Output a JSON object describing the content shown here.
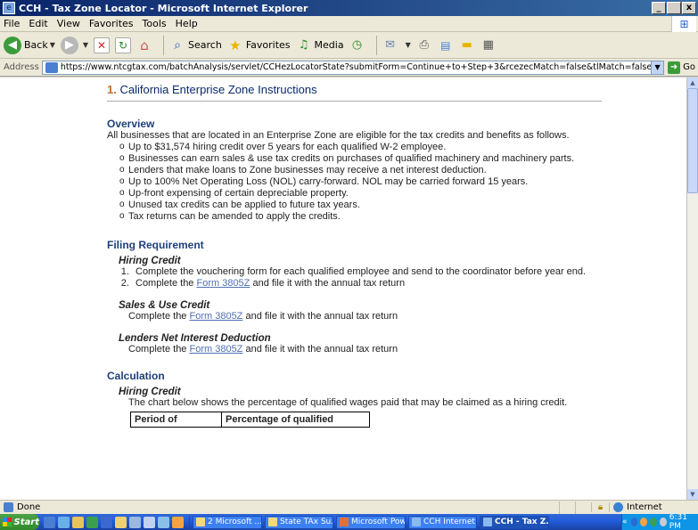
{
  "window": {
    "title": "CCH - Tax Zone Locator - Microsoft Internet Explorer",
    "min": "_",
    "max": " ",
    "close": "x"
  },
  "menu": [
    "File",
    "Edit",
    "View",
    "Favorites",
    "Tools",
    "Help"
  ],
  "toolbar": {
    "back": "Back",
    "search": "Search",
    "favorites": "Favorites",
    "media": "Media"
  },
  "address": {
    "label": "Address",
    "url": "https://www.ntcgtax.com/batchAnalysis/servlet/CCHezLocatorState?submitForm=Continue+to+Step+3&rcezecMatch=false&tlMatch=false&goMatch=false&ezMatch=true&ezName=",
    "go": "Go"
  },
  "page": {
    "heading_num": "1.",
    "heading": "California Enterprise Zone Instructions",
    "overview_title": "Overview",
    "overview_text": "All businesses that are located in an Enterprise Zone are eligible for the tax credits and benefits as follows.",
    "overview_items": [
      "Up to $31,574 hiring credit over 5 years for each qualified W-2 employee.",
      "Businesses can earn sales & use tax credits on purchases of qualified machinery and machinery parts.",
      "Lenders that make loans to Zone businesses may receive a net interest deduction.",
      "Up to 100% Net Operating Loss (NOL) carry-forward. NOL may be carried forward 15 years.",
      "Up-front expensing of certain depreciable property.",
      "Unused tax credits can be applied to future tax years.",
      "Tax returns can be amended to apply the credits."
    ],
    "filing_title": "Filing Requirement",
    "hiring_credit": "Hiring Credit",
    "hiring_steps": {
      "step1": "Complete the vouchering form for each qualified employee and send to the coordinator before year end.",
      "step2_pre": "Complete the ",
      "step2_link": "Form 3805Z",
      "step2_post": " and file it with the annual tax return"
    },
    "sales_use": "Sales & Use Credit",
    "sales_pre": "Complete the ",
    "sales_link": "Form 3805Z",
    "sales_post": " and file it with the annual tax return",
    "lenders": "Lenders Net Interest Deduction",
    "lenders_pre": "Complete the ",
    "lenders_link": "Form 3805Z",
    "lenders_post": " and file it with the annual tax return",
    "calc_title": "Calculation",
    "calc_hiring": "Hiring Credit",
    "calc_text": "The chart below shows the percentage of qualified wages paid that may be claimed as a hiring credit.",
    "table_col1": "Period of",
    "table_col2": "Percentage of qualified"
  },
  "status": {
    "done": "Done",
    "zone": "Internet"
  },
  "taskbar": {
    "start": "Start",
    "tasks": [
      "2 Microsoft ...",
      "State TAx Su...",
      "Microsoft Pow...",
      "CCH Internet ...",
      "CCH - Tax Z..."
    ],
    "clock": "6:31 PM",
    "expand": "«"
  }
}
